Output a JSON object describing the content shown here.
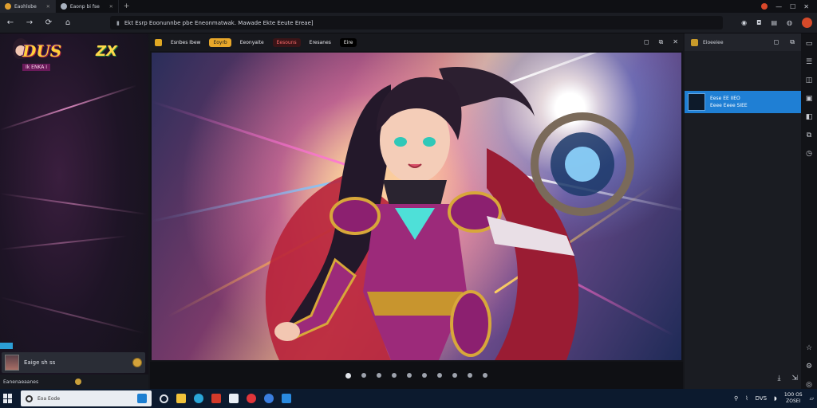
{
  "browser": {
    "tabs": [
      {
        "label": "Eaohlobe"
      },
      {
        "label": "Eaonp bi fse"
      }
    ],
    "new_tab_glyph": "+",
    "url": "Ekt Esrp Eoonunnbe pbe Eneonmatwak. Mawade Ekte Eeute Ereae]",
    "window_buttons": [
      "—",
      "☐",
      "✕"
    ],
    "accent_colors": {
      "avatar": "#d64a2a",
      "tab_favicon": "#e0a030"
    }
  },
  "left_sidebar": {
    "logo_text": "DUS",
    "logo_subtitle": "Ik ENKA I",
    "logo_emblem": "ZX",
    "user": {
      "name": "Eaige sh ss"
    },
    "status_text": "Eanenaeaanes"
  },
  "viewer": {
    "header_pills": [
      {
        "label": "Esnbes Ibew",
        "style": "plain"
      },
      {
        "label": "Eoyrb",
        "style": "gold"
      },
      {
        "label": "Eeonyaite",
        "style": "plain"
      },
      {
        "label": "Eesouns",
        "style": "red"
      },
      {
        "label": "Eresanes",
        "style": "plain"
      },
      {
        "label": "Eire",
        "style": "dark"
      }
    ],
    "controls": [
      "◻",
      "⧉",
      "✕"
    ],
    "image_description": "anime heroine in armor with glowing shield",
    "pager": {
      "count": 10,
      "active_index": 0
    }
  },
  "right_panel": {
    "title": "Eioeeiee",
    "controls": [
      "◻",
      "⧉"
    ],
    "selected_item": {
      "line1": "Eese EE IIEO",
      "line2": "Eeee Eeee SIEE"
    },
    "selected_color": "#1f7fd4",
    "footer_icons": [
      "⤓",
      "⇲"
    ]
  },
  "right_rail": {
    "icons": [
      "window-icon",
      "list-icon",
      "bag-icon",
      "image-icon",
      "layers-icon",
      "copy-icon",
      "history-icon",
      "star-icon",
      "settings-icon",
      "globe-icon"
    ]
  },
  "taskbar": {
    "search_placeholder": "Eoa Eode",
    "apps": [
      "cortana-icon",
      "file-explorer-icon",
      "edge-icon",
      "office-icon",
      "docs-icon",
      "opera-icon",
      "chrome-icon",
      "store-icon"
    ],
    "tray_text": "DVS",
    "clock_time": "1O0 OS",
    "clock_date": "ZOSEI"
  }
}
